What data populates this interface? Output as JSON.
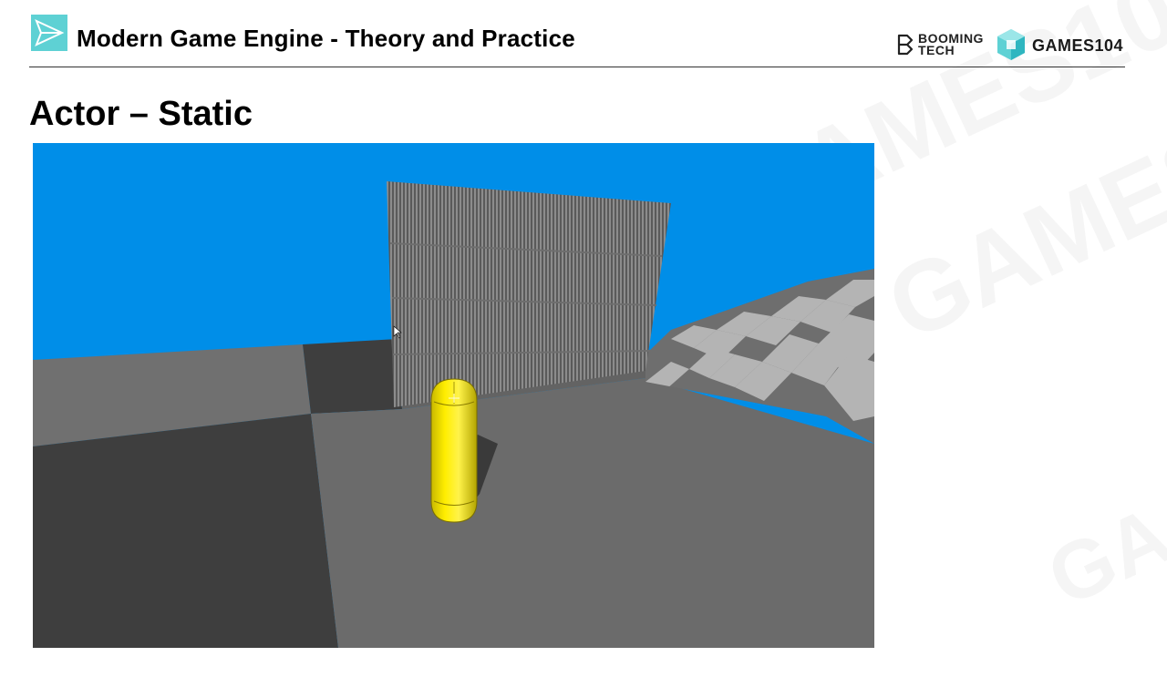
{
  "header": {
    "title": "Modern Game Engine - Theory and Practice",
    "logo_icon": "paper-plane-icon",
    "brand_booming_line1": "BOOMING",
    "brand_booming_line2": "TECH",
    "brand_games": "GAMES104",
    "accent_color": "#5ed1d4"
  },
  "slide": {
    "title": "Actor – Static"
  },
  "scene": {
    "sky_color": "#008ee8",
    "floor_color": "#6b6b6b",
    "actor_color": "#ffee00"
  }
}
